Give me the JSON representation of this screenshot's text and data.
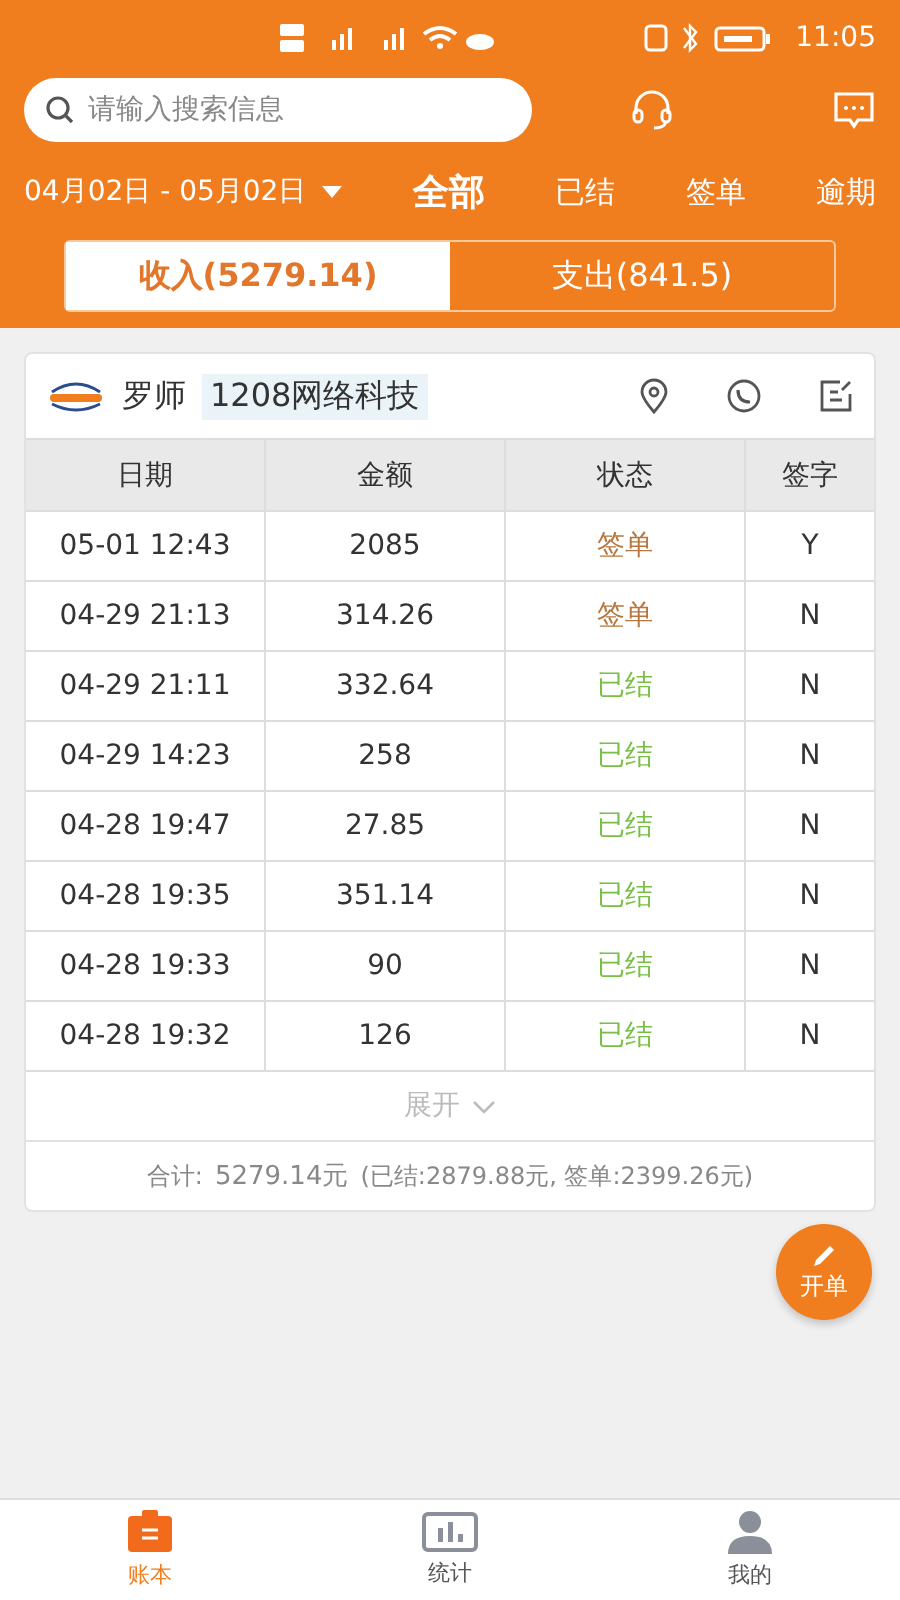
{
  "status_bar": {
    "time": "11:05"
  },
  "search": {
    "placeholder": "请输入搜索信息"
  },
  "date_range": "04月02日 - 05月02日",
  "filters": [
    {
      "label": "全部",
      "selected": true
    },
    {
      "label": "已结",
      "selected": false
    },
    {
      "label": "签单",
      "selected": false
    },
    {
      "label": "逾期",
      "selected": false
    }
  ],
  "segments": [
    {
      "label": "收入(5279.14)",
      "selected": true
    },
    {
      "label": "支出(841.5)",
      "selected": false
    }
  ],
  "card": {
    "name": "罗师",
    "tag": "1208网络科技",
    "columns": [
      "日期",
      "金额",
      "状态",
      "签字"
    ],
    "rows": [
      {
        "date": "05-01 12:43",
        "amount": "2085",
        "status": "签单",
        "kind": "signed",
        "signature": "Y"
      },
      {
        "date": "04-29 21:13",
        "amount": "314.26",
        "status": "签单",
        "kind": "signed",
        "signature": "N"
      },
      {
        "date": "04-29 21:11",
        "amount": "332.64",
        "status": "已结",
        "kind": "settled",
        "signature": "N"
      },
      {
        "date": "04-29 14:23",
        "amount": "258",
        "status": "已结",
        "kind": "settled",
        "signature": "N"
      },
      {
        "date": "04-28 19:47",
        "amount": "27.85",
        "status": "已结",
        "kind": "settled",
        "signature": "N"
      },
      {
        "date": "04-28 19:35",
        "amount": "351.14",
        "status": "已结",
        "kind": "settled",
        "signature": "N"
      },
      {
        "date": "04-28 19:33",
        "amount": "90",
        "status": "已结",
        "kind": "settled",
        "signature": "N"
      },
      {
        "date": "04-28 19:32",
        "amount": "126",
        "status": "已结",
        "kind": "settled",
        "signature": "N"
      }
    ],
    "expand": "展开",
    "total_label": "合计:",
    "total": "5279.14元",
    "breakdown": "(已结:2879.88元, 签单:2399.26元)"
  },
  "fab": "开单",
  "nav": [
    {
      "label": "账本",
      "selected": true,
      "kind": "book"
    },
    {
      "label": "统计",
      "selected": false,
      "kind": "chart"
    },
    {
      "label": "我的",
      "selected": false,
      "kind": "user"
    }
  ]
}
